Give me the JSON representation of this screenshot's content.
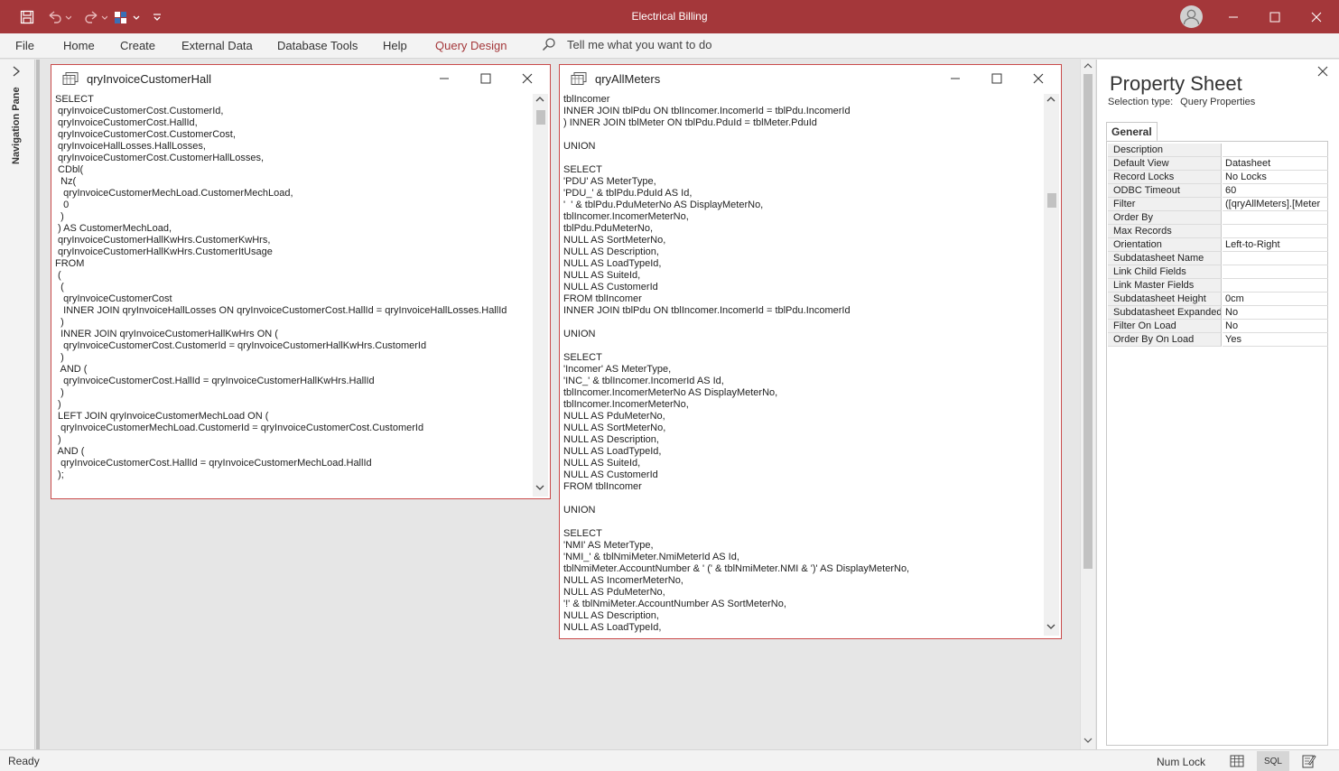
{
  "app": {
    "title": "Electrical Billing",
    "title_bar_color": "#a4373a",
    "accent_color": "#a4373a"
  },
  "quick_access": {
    "icons": [
      "save-icon",
      "undo-icon",
      "redo-icon",
      "view-switch-icon",
      "customize-qat-icon"
    ]
  },
  "ribbon": {
    "tabs": [
      {
        "label": "File",
        "active": false
      },
      {
        "label": "Home",
        "active": false
      },
      {
        "label": "Create",
        "active": false
      },
      {
        "label": "External Data",
        "active": false
      },
      {
        "label": "Database Tools",
        "active": false
      },
      {
        "label": "Help",
        "active": false
      },
      {
        "label": "Query Design",
        "active": true
      }
    ],
    "tell_me": "Tell me what you want to do"
  },
  "nav_pane": {
    "label": "Navigation Pane"
  },
  "windows": [
    {
      "title": "qryInvoiceCustomerHall",
      "sql": "SELECT\n qryInvoiceCustomerCost.CustomerId,\n qryInvoiceCustomerCost.HallId,\n qryInvoiceCustomerCost.CustomerCost,\n qryInvoiceHallLosses.HallLosses,\n qryInvoiceCustomerCost.CustomerHallLosses,\n CDbl(\n  Nz(\n   qryInvoiceCustomerMechLoad.CustomerMechLoad,\n   0\n  )\n ) AS CustomerMechLoad,\n qryInvoiceCustomerHallKwHrs.CustomerKwHrs,\n qryInvoiceCustomerHallKwHrs.CustomerItUsage\nFROM\n (\n  (\n   qryInvoiceCustomerCost\n   INNER JOIN qryInvoiceHallLosses ON qryInvoiceCustomerCost.HallId = qryInvoiceHallLosses.HallId\n  )\n  INNER JOIN qryInvoiceCustomerHallKwHrs ON (\n   qryInvoiceCustomerCost.CustomerId = qryInvoiceCustomerHallKwHrs.CustomerId\n  )\n  AND (\n   qryInvoiceCustomerCost.HallId = qryInvoiceCustomerHallKwHrs.HallId\n  )\n )\n LEFT JOIN qryInvoiceCustomerMechLoad ON (\n  qryInvoiceCustomerMechLoad.CustomerId = qryInvoiceCustomerCost.CustomerId\n )\n AND (\n  qryInvoiceCustomerCost.HallId = qryInvoiceCustomerMechLoad.HallId\n );"
    },
    {
      "title": "qryAllMeters",
      "sql": "tblIncomer\nINNER JOIN tblPdu ON tblIncomer.IncomerId = tblPdu.IncomerId\n) INNER JOIN tblMeter ON tblPdu.PduId = tblMeter.PduId\n\nUNION\n\nSELECT\n'PDU' AS MeterType,\n'PDU_' & tblPdu.PduId AS Id,\n'  ' & tblPdu.PduMeterNo AS DisplayMeterNo,\ntblIncomer.IncomerMeterNo,\ntblPdu.PduMeterNo,\nNULL AS SortMeterNo,\nNULL AS Description,\nNULL AS LoadTypeId,\nNULL AS SuiteId,\nNULL AS CustomerId\nFROM tblIncomer\nINNER JOIN tblPdu ON tblIncomer.IncomerId = tblPdu.IncomerId\n\nUNION\n\nSELECT\n'Incomer' AS MeterType,\n'INC_' & tblIncomer.IncomerId AS Id,\ntblIncomer.IncomerMeterNo AS DisplayMeterNo,\ntblIncomer.IncomerMeterNo,\nNULL AS PduMeterNo,\nNULL AS SortMeterNo,\nNULL AS Description,\nNULL AS LoadTypeId,\nNULL AS SuiteId,\nNULL AS CustomerId\nFROM tblIncomer\n\nUNION\n\nSELECT\n'NMI' AS MeterType,\n'NMI_' & tblNmiMeter.NmiMeterId AS Id,\ntblNmiMeter.AccountNumber & ' (' & tblNmiMeter.NMI & ')' AS DisplayMeterNo,\nNULL AS IncomerMeterNo,\nNULL AS PduMeterNo,\n'!' & tblNmiMeter.AccountNumber AS SortMeterNo,\nNULL AS Description,\nNULL AS LoadTypeId,"
    }
  ],
  "property_sheet": {
    "title": "Property Sheet",
    "selection_type_label": "Selection type:",
    "selection_type_value": "Query Properties",
    "tab": "General",
    "rows": [
      {
        "name": "Description",
        "value": ""
      },
      {
        "name": "Default View",
        "value": "Datasheet"
      },
      {
        "name": "Record Locks",
        "value": "No Locks"
      },
      {
        "name": "ODBC Timeout",
        "value": "60"
      },
      {
        "name": "Filter",
        "value": "([qryAllMeters].[Meter"
      },
      {
        "name": "Order By",
        "value": ""
      },
      {
        "name": "Max Records",
        "value": ""
      },
      {
        "name": "Orientation",
        "value": "Left-to-Right"
      },
      {
        "name": "Subdatasheet Name",
        "value": ""
      },
      {
        "name": "Link Child Fields",
        "value": ""
      },
      {
        "name": "Link Master Fields",
        "value": ""
      },
      {
        "name": "Subdatasheet Height",
        "value": "0cm"
      },
      {
        "name": "Subdatasheet Expanded",
        "value": "No"
      },
      {
        "name": "Filter On Load",
        "value": "No"
      },
      {
        "name": "Order By On Load",
        "value": "Yes"
      }
    ]
  },
  "status_bar": {
    "status": "Ready",
    "num_lock": "Num Lock",
    "views": [
      {
        "name": "datasheet-view-icon",
        "label": ""
      },
      {
        "name": "sql-view",
        "label": "SQL"
      },
      {
        "name": "design-view-icon",
        "label": ""
      }
    ]
  }
}
